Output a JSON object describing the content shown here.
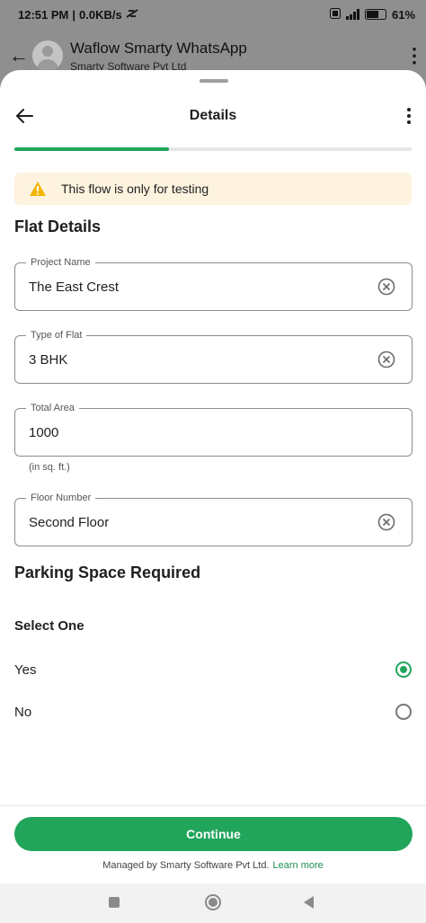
{
  "status_bar": {
    "time": "12:51 PM",
    "network_speed": "0.0KB/s",
    "battery": "61"
  },
  "chat": {
    "title": "Waflow Smarty WhatsApp",
    "subtitle": "Smarty Software Pvt Ltd"
  },
  "sheet": {
    "title": "Details",
    "progress": 0.39,
    "banner": "This flow is only for testing",
    "section_title": "Flat Details",
    "fields": [
      {
        "label": "Project Name",
        "value": "The East Crest",
        "clearable": true
      },
      {
        "label": "Type of Flat",
        "value": "3 BHK",
        "clearable": true
      },
      {
        "label": "Total Area",
        "value": "1000",
        "clearable": false,
        "helper": "(in sq. ft.)"
      },
      {
        "label": "Floor Number",
        "value": "Second Floor",
        "clearable": true
      }
    ],
    "parking": {
      "title": "Parking Space Required",
      "select_label": "Select One",
      "options": [
        {
          "label": "Yes",
          "selected": true
        },
        {
          "label": "No",
          "selected": false
        }
      ]
    },
    "continue_label": "Continue",
    "managed_text": "Managed by Smarty Software Pvt Ltd.",
    "learn_more": "Learn more"
  },
  "colors": {
    "accent": "#21a55b",
    "banner_bg": "#fdf3df",
    "warning": "#f4b400"
  },
  "icons": [
    "back-arrow-icon",
    "kebab-menu-icon",
    "warning-icon",
    "clear-icon",
    "recent-apps-icon",
    "home-icon",
    "nav-back-icon"
  ]
}
